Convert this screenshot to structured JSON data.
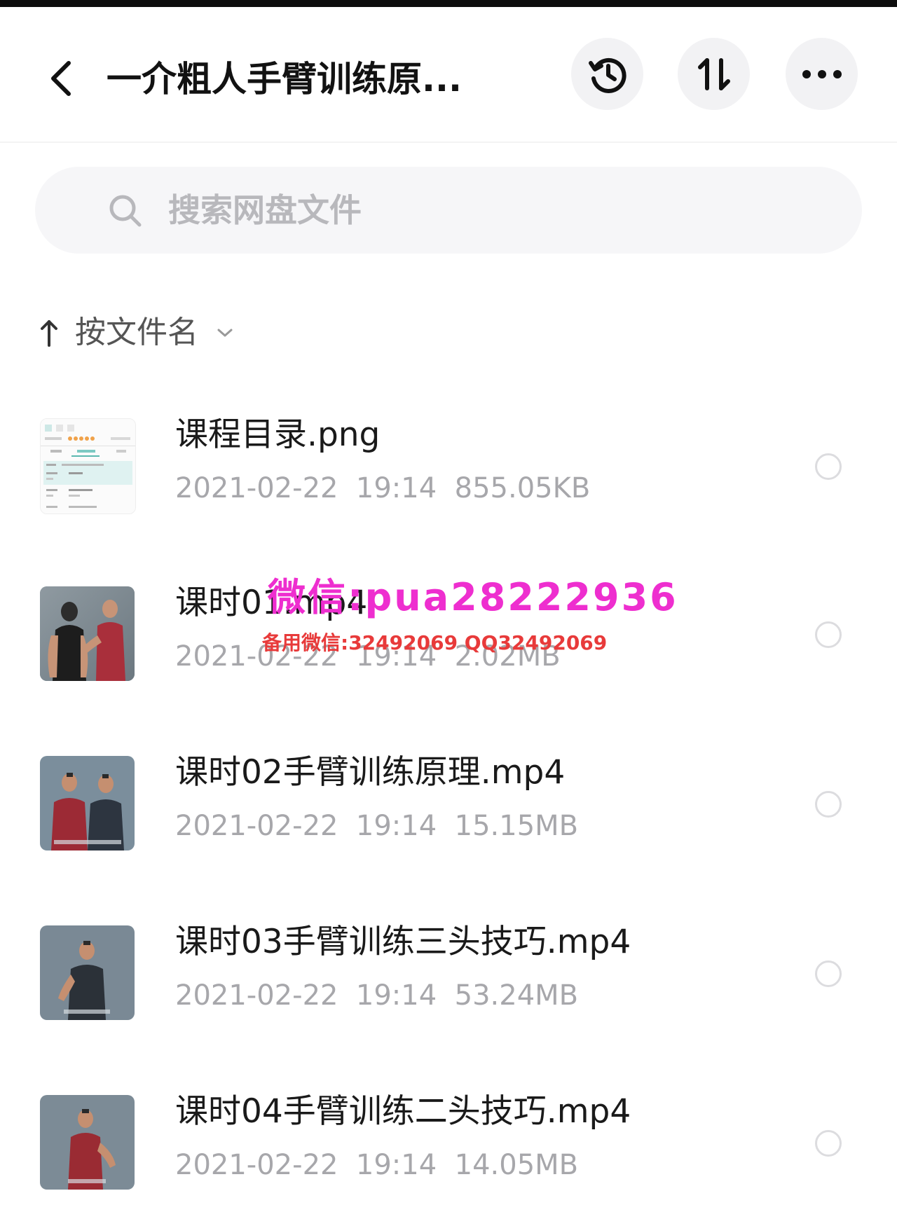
{
  "header": {
    "title": "一介粗人手臂训练原...",
    "history_icon": "history-clock-icon",
    "sort_icon": "sort-updown-icon",
    "more_icon": "more-dots-icon"
  },
  "search": {
    "placeholder": "搜索网盘文件"
  },
  "sort": {
    "label": "按文件名",
    "direction_icon": "arrow-up-icon"
  },
  "files": [
    {
      "name": "课程目录.png",
      "date": "2021-02-22",
      "time": "19:14",
      "size": "855.05KB",
      "thumb": "document-thumb"
    },
    {
      "name": "课时01.mp4",
      "date": "2021-02-22",
      "time": "19:14",
      "size": "2.02MB",
      "thumb": "video-thumb"
    },
    {
      "name": "课时02手臂训练原理.mp4",
      "date": "2021-02-22",
      "time": "19:14",
      "size": "15.15MB",
      "thumb": "video-thumb"
    },
    {
      "name": "课时03手臂训练三头技巧.mp4",
      "date": "2021-02-22",
      "time": "19:14",
      "size": "53.24MB",
      "thumb": "video-thumb"
    },
    {
      "name": "课时04手臂训练二头技巧.mp4",
      "date": "2021-02-22",
      "time": "19:14",
      "size": "14.05MB",
      "thumb": "video-thumb"
    }
  ],
  "watermark": {
    "main": "微信:pua28222936",
    "sub": "备用微信:32492069 QQ32492069"
  },
  "colors": {
    "accent_watermark": "#ee2ecf",
    "watermark_sub": "#e83a3a",
    "meta_text": "#a7a7ab"
  }
}
